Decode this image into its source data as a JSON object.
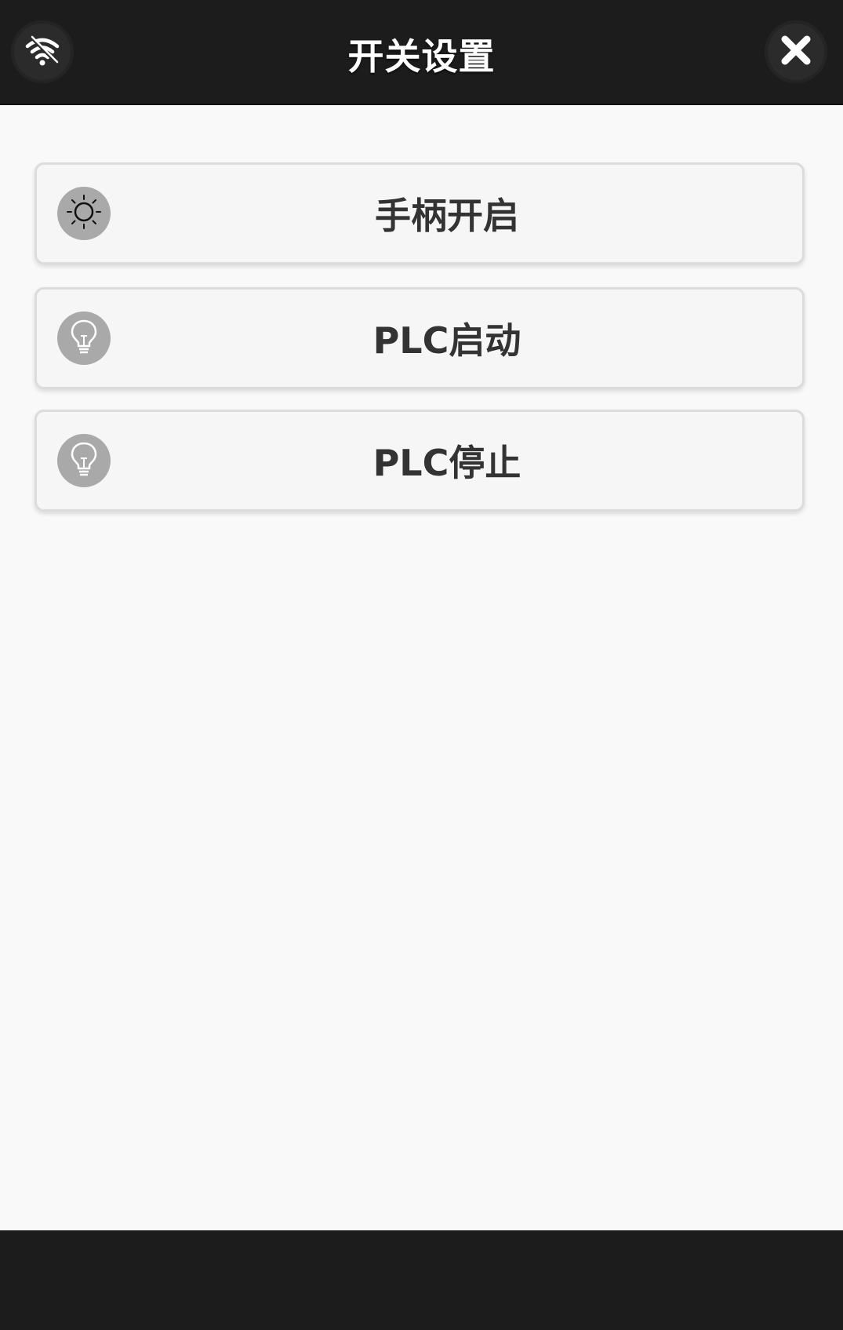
{
  "header": {
    "title": "开关设置",
    "left_icon": "wifi-icon",
    "right_icon": "close-icon"
  },
  "buttons": [
    {
      "label": "手柄开启",
      "icon": "sun-icon"
    },
    {
      "label": "PLC启动",
      "icon": "lightbulb-icon"
    },
    {
      "label": "PLC停止",
      "icon": "lightbulb-icon"
    }
  ],
  "colors": {
    "header_bg": "#1c1c1c",
    "content_bg": "#f9f9f9",
    "button_bg": "#f6f6f6",
    "icon_circle": "#a9a9a9",
    "label_text": "#333333"
  }
}
